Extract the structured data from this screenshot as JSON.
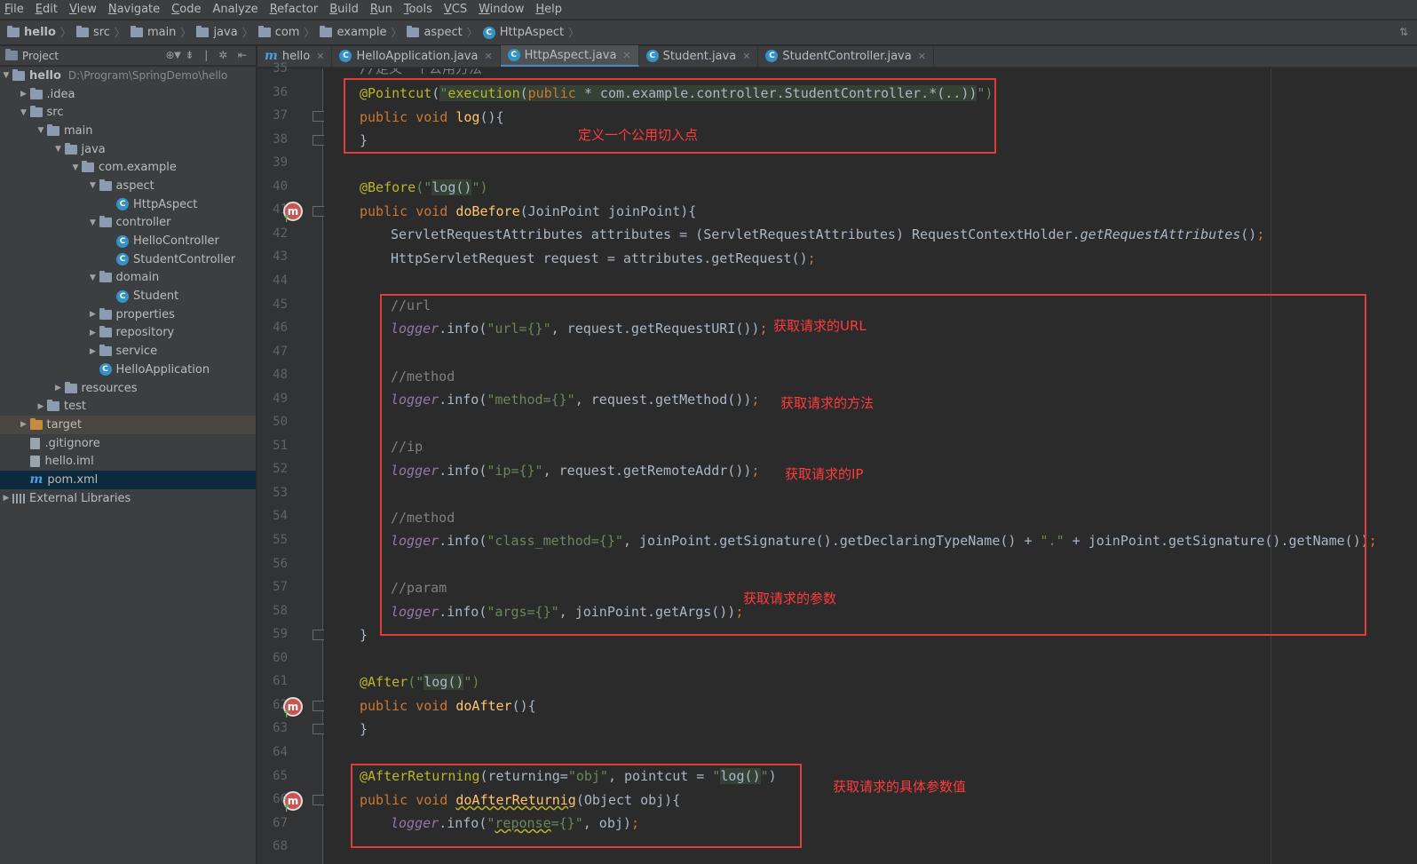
{
  "menu": [
    {
      "u": "F",
      "rest": "ile"
    },
    {
      "u": "E",
      "rest": "dit"
    },
    {
      "u": "V",
      "rest": "iew"
    },
    {
      "u": "N",
      "rest": "avigate"
    },
    {
      "u": "C",
      "rest": "ode"
    },
    {
      "u": "",
      "rest": "Analyze"
    },
    {
      "u": "R",
      "rest": "efactor"
    },
    {
      "u": "B",
      "rest": "uild"
    },
    {
      "u": "R",
      "rest": "un"
    },
    {
      "u": "T",
      "rest": "ools"
    },
    {
      "u": "V",
      "rest": "CS"
    },
    {
      "u": "W",
      "rest": "indow"
    },
    {
      "u": "H",
      "rest": "elp"
    }
  ],
  "breadcrumb": [
    "hello",
    "src",
    "main",
    "java",
    "com",
    "example",
    "aspect",
    "HttpAspect"
  ],
  "project_panel": {
    "title": "Project",
    "tools": "⊕ ⇟ | ✲ ⇤"
  },
  "tree": [
    {
      "label": "hello",
      "path": "D:\\Program\\SpringDemo\\hello",
      "arrow": "▼"
    },
    {
      "label": ".idea",
      "arrow": "▶"
    },
    {
      "label": "src",
      "arrow": "▼"
    },
    {
      "label": "main",
      "arrow": "▼"
    },
    {
      "label": "java",
      "arrow": "▼"
    },
    {
      "label": "com.example",
      "arrow": "▼"
    },
    {
      "label": "aspect",
      "arrow": "▼"
    },
    {
      "label": "HttpAspect",
      "arrow": ""
    },
    {
      "label": "controller",
      "arrow": "▼"
    },
    {
      "label": "HelloController",
      "arrow": ""
    },
    {
      "label": "StudentController",
      "arrow": ""
    },
    {
      "label": "domain",
      "arrow": "▼"
    },
    {
      "label": "Student",
      "arrow": ""
    },
    {
      "label": "properties",
      "arrow": "▶"
    },
    {
      "label": "repository",
      "arrow": "▶"
    },
    {
      "label": "service",
      "arrow": "▶"
    },
    {
      "label": "HelloApplication",
      "arrow": ""
    },
    {
      "label": "resources",
      "arrow": "▶"
    },
    {
      "label": "test",
      "arrow": "▶"
    },
    {
      "label": "target",
      "arrow": "▶"
    },
    {
      "label": ".gitignore",
      "arrow": ""
    },
    {
      "label": "hello.iml",
      "arrow": ""
    },
    {
      "label": "pom.xml",
      "arrow": ""
    },
    {
      "label": "External Libraries",
      "arrow": "▶"
    }
  ],
  "tabs": [
    {
      "label": "hello"
    },
    {
      "label": "HelloApplication.java"
    },
    {
      "label": "HttpAspect.java"
    },
    {
      "label": "Student.java"
    },
    {
      "label": "StudentController.java"
    }
  ],
  "line_numbers": [
    "35",
    "36",
    "37",
    "38",
    "39",
    "40",
    "41",
    "42",
    "43",
    "44",
    "45",
    "46",
    "47",
    "48",
    "49",
    "50",
    "51",
    "52",
    "53",
    "54",
    "55",
    "56",
    "57",
    "58",
    "59",
    "60",
    "61",
    "62",
    "63",
    "64",
    "65",
    "66",
    "67",
    "68"
  ],
  "code": {
    "l35": "//定义一个公用方法",
    "l36_ann": "@Pointcut",
    "l36_p1": "(",
    "l36_str": "\"",
    "l36_exec": "execution",
    "l36_p2": "(",
    "l36_kw": "public",
    "l36_rest": " * com.example.controller.StudentController.*(..))",
    "l36_end": "\")",
    "l37_kw": "public void ",
    "l37_fn": "log",
    "l37_rest": "(){",
    "l38": "}",
    "l40_ann": "@Before",
    "l40_str1": "(\"",
    "l40_m": "log()",
    "l40_str2": "\")",
    "l41_kw": "public void ",
    "l41_fn": "doBefore",
    "l41_rest": "(JoinPoint joinPoint){",
    "l42_a": "ServletRequestAttributes attributes = (ServletRequestAttributes) RequestContextHolder.",
    "l42_it": "getRequestAttributes",
    "l42_b": "()",
    "l42_semi": ";",
    "l43_a": "HttpServletRequest request = attributes.getRequest()",
    "l43_semi": ";",
    "l45": "//url",
    "l46_logger": "logger",
    "l46_a": ".info(",
    "l46_str": "\"url={}\"",
    "l46_b": ", request.getRequestURI())",
    "l46_semi": ";",
    "l48": "//method",
    "l49_logger": "logger",
    "l49_a": ".info(",
    "l49_str": "\"method={}\"",
    "l49_b": ", request.getMethod())",
    "l49_semi": ";",
    "l51": "//ip",
    "l52_logger": "logger",
    "l52_a": ".info(",
    "l52_str": "\"ip={}\"",
    "l52_b": ", request.getRemoteAddr())",
    "l52_semi": ";",
    "l54": "//method",
    "l55_logger": "logger",
    "l55_a": ".info(",
    "l55_str": "\"class_method={}\"",
    "l55_b": ", joinPoint.getSignature().getDeclaringTypeName() + ",
    "l55_str2": "\".\"",
    "l55_c": " + joinPoint.getSignature().getName())",
    "l55_semi": ";",
    "l57": "//param",
    "l58_logger": "logger",
    "l58_a": ".info(",
    "l58_str": "\"args={}\"",
    "l58_b": ", joinPoint.getArgs())",
    "l58_semi": ";",
    "l59": "}",
    "l61_ann": "@After",
    "l61_str1": "(\"",
    "l61_m": "log()",
    "l61_str2": "\")",
    "l62_kw": "public void ",
    "l62_fn": "doAfter",
    "l62_rest": "(){",
    "l63": "}",
    "l65_ann": "@AfterReturning",
    "l65_a": "(returning=",
    "l65_str": "\"obj\"",
    "l65_b": ", pointcut = ",
    "l65_str2a": "\"",
    "l65_m": "log()",
    "l65_str2b": "\"",
    "l65_c": ")",
    "l66_kw": "public void ",
    "l66_fn": "doAfterReturnig",
    "l66_rest": "(Object obj){",
    "l67_logger": "logger",
    "l67_a": ".info(",
    "l67_str1": "\"",
    "l67_sq": "reponse",
    "l67_str2": "={}\"",
    "l67_b": ", obj)",
    "l67_semi": ";"
  },
  "annotations": {
    "pointcut": "定义一个公用切入点",
    "url": "获取请求的URL",
    "method": "获取请求的方法",
    "ip": "获取请求的IP",
    "args": "获取请求的参数",
    "return_value": "获取请求的具体参数值"
  },
  "gutter_method_icon": "m",
  "colors": {
    "annotation_red": "#e03c3c",
    "keyword": "#cc7832",
    "string": "#6a8759",
    "comment": "#808080",
    "method": "#ffc66d",
    "field": "#9876aa"
  }
}
